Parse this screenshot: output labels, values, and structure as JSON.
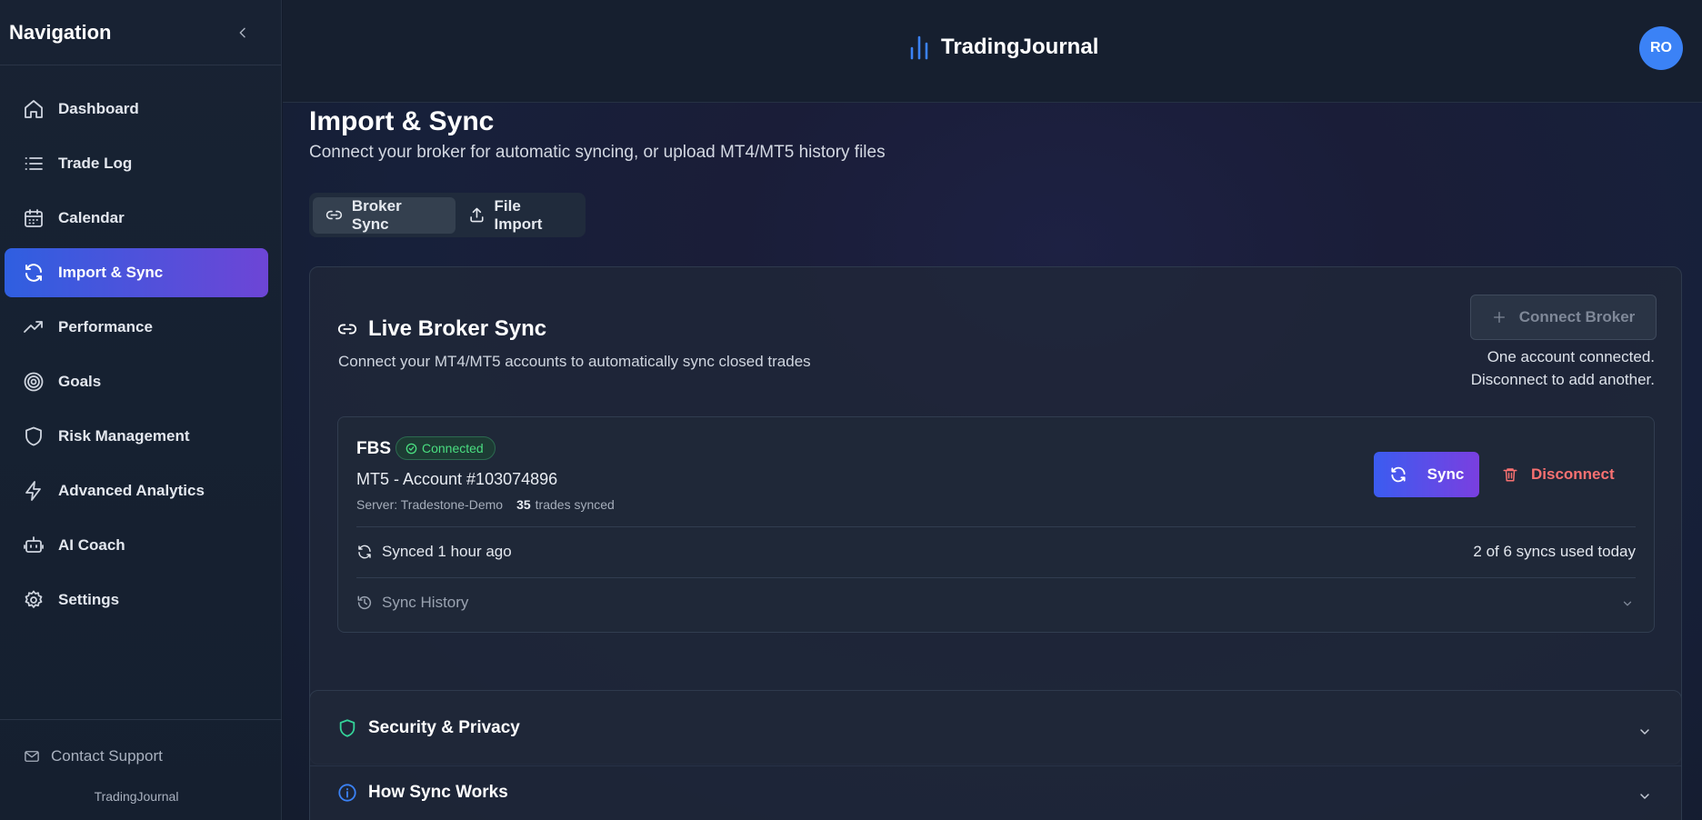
{
  "sidebar": {
    "title": "Navigation",
    "items": [
      {
        "label": "Dashboard",
        "icon": "home-icon"
      },
      {
        "label": "Trade Log",
        "icon": "list-icon"
      },
      {
        "label": "Calendar",
        "icon": "calendar-icon"
      },
      {
        "label": "Import & Sync",
        "icon": "refresh-icon",
        "active": true
      },
      {
        "label": "Performance",
        "icon": "trending-up-icon"
      },
      {
        "label": "Goals",
        "icon": "target-icon"
      },
      {
        "label": "Risk Management",
        "icon": "shield-icon"
      },
      {
        "label": "Advanced Analytics",
        "icon": "lightning-icon"
      },
      {
        "label": "AI Coach",
        "icon": "robot-icon"
      },
      {
        "label": "Settings",
        "icon": "gear-icon"
      }
    ],
    "support_label": "Contact Support",
    "brand": "TradingJournal"
  },
  "header": {
    "logo_text": "TradingJournal",
    "avatar_initials": "RO"
  },
  "page": {
    "title": "Import & Sync",
    "subtitle": "Connect your broker for automatic syncing, or upload MT4/MT5 history files",
    "tabs": [
      {
        "label": "Broker Sync",
        "active": true
      },
      {
        "label": "File Import",
        "active": false
      }
    ]
  },
  "live_sync": {
    "title": "Live Broker Sync",
    "subtitle": "Connect your MT4/MT5 accounts to automatically sync closed trades",
    "connect_button": "Connect Broker",
    "note_line1": "One account connected.",
    "note_line2": "Disconnect to add another.",
    "account": {
      "broker": "FBS",
      "status": "Connected",
      "name": "MT5 - Account #103074896",
      "server": "Server: Tradestone-Demo",
      "trades_count": "35",
      "trades_label": "trades synced",
      "sync_button": "Sync",
      "disconnect_button": "Disconnect",
      "last_synced": "Synced 1 hour ago",
      "usage": "2 of 6 syncs used today",
      "history_label": "Sync History"
    }
  },
  "accordions": [
    {
      "title": "Security & Privacy",
      "icon": "shield-icon"
    },
    {
      "title": "How Sync Works",
      "icon": "info-icon"
    }
  ],
  "colors": {
    "accent_start": "#2f5fe0",
    "accent_end": "#6d45d6",
    "success": "#4ade80",
    "danger": "#f87171",
    "avatar": "#3b82f6"
  }
}
